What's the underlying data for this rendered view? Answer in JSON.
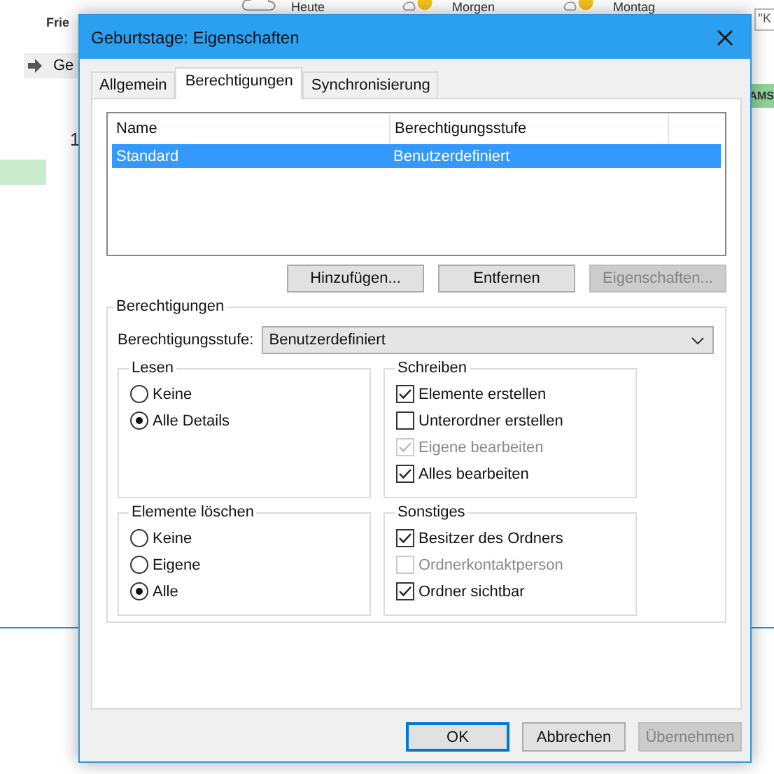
{
  "background": {
    "location": "Frie",
    "weather": [
      {
        "label": "Heute",
        "kind": "cloud"
      },
      {
        "label": "Morgen",
        "kind": "sun"
      },
      {
        "label": "Montag",
        "kind": "sun"
      }
    ],
    "search_stub": "\"K",
    "nav_label": "Ge",
    "day_header": "AMS",
    "day_number": "1"
  },
  "window": {
    "title": "Geburtstage: Eigenschaften"
  },
  "tabs": [
    {
      "label": "Allgemein",
      "selected": false
    },
    {
      "label": "Berechtigungen",
      "selected": true
    },
    {
      "label": "Synchronisierung",
      "selected": false
    }
  ],
  "permissions_table": {
    "columns": [
      "Name",
      "Berechtigungsstufe"
    ],
    "rows": [
      {
        "cells": [
          "Standard",
          "Benutzerdefiniert"
        ],
        "selected": true
      }
    ]
  },
  "list_buttons": [
    {
      "label": "Hinzufügen...",
      "disabled": false
    },
    {
      "label": "Entfernen",
      "disabled": false
    },
    {
      "label": "Eigenschaften...",
      "disabled": true
    }
  ],
  "permissions_group": {
    "title": "Berechtigungen",
    "level_label": "Berechtigungsstufe:",
    "level_value": "Benutzerdefiniert"
  },
  "groups": [
    {
      "title": "Lesen",
      "kind": "radio",
      "items": [
        {
          "label": "Keine",
          "selected": false,
          "disabled": false
        },
        {
          "label": "Alle Details",
          "selected": true,
          "disabled": false
        }
      ]
    },
    {
      "title": "Schreiben",
      "kind": "check",
      "items": [
        {
          "label": "Elemente erstellen",
          "checked": true,
          "disabled": false
        },
        {
          "label": "Unterordner erstellen",
          "checked": false,
          "disabled": false
        },
        {
          "label": "Eigene bearbeiten",
          "checked": true,
          "disabled": true
        },
        {
          "label": "Alles bearbeiten",
          "checked": true,
          "disabled": false
        }
      ]
    },
    {
      "title": "Elemente löschen",
      "kind": "radio",
      "items": [
        {
          "label": "Keine",
          "selected": false,
          "disabled": false
        },
        {
          "label": "Eigene",
          "selected": false,
          "disabled": false
        },
        {
          "label": "Alle",
          "selected": true,
          "disabled": false
        }
      ]
    },
    {
      "title": "Sonstiges",
      "kind": "check",
      "items": [
        {
          "label": "Besitzer des Ordners",
          "checked": true,
          "disabled": false
        },
        {
          "label": "Ordnerkontaktperson",
          "checked": false,
          "disabled": true
        },
        {
          "label": "Ordner sichtbar",
          "checked": true,
          "disabled": false
        }
      ]
    }
  ],
  "dialog_buttons": [
    {
      "label": "OK",
      "disabled": false,
      "default": true
    },
    {
      "label": "Abbrechen",
      "disabled": false,
      "default": false
    },
    {
      "label": "Übernehmen",
      "disabled": true,
      "default": false
    }
  ]
}
